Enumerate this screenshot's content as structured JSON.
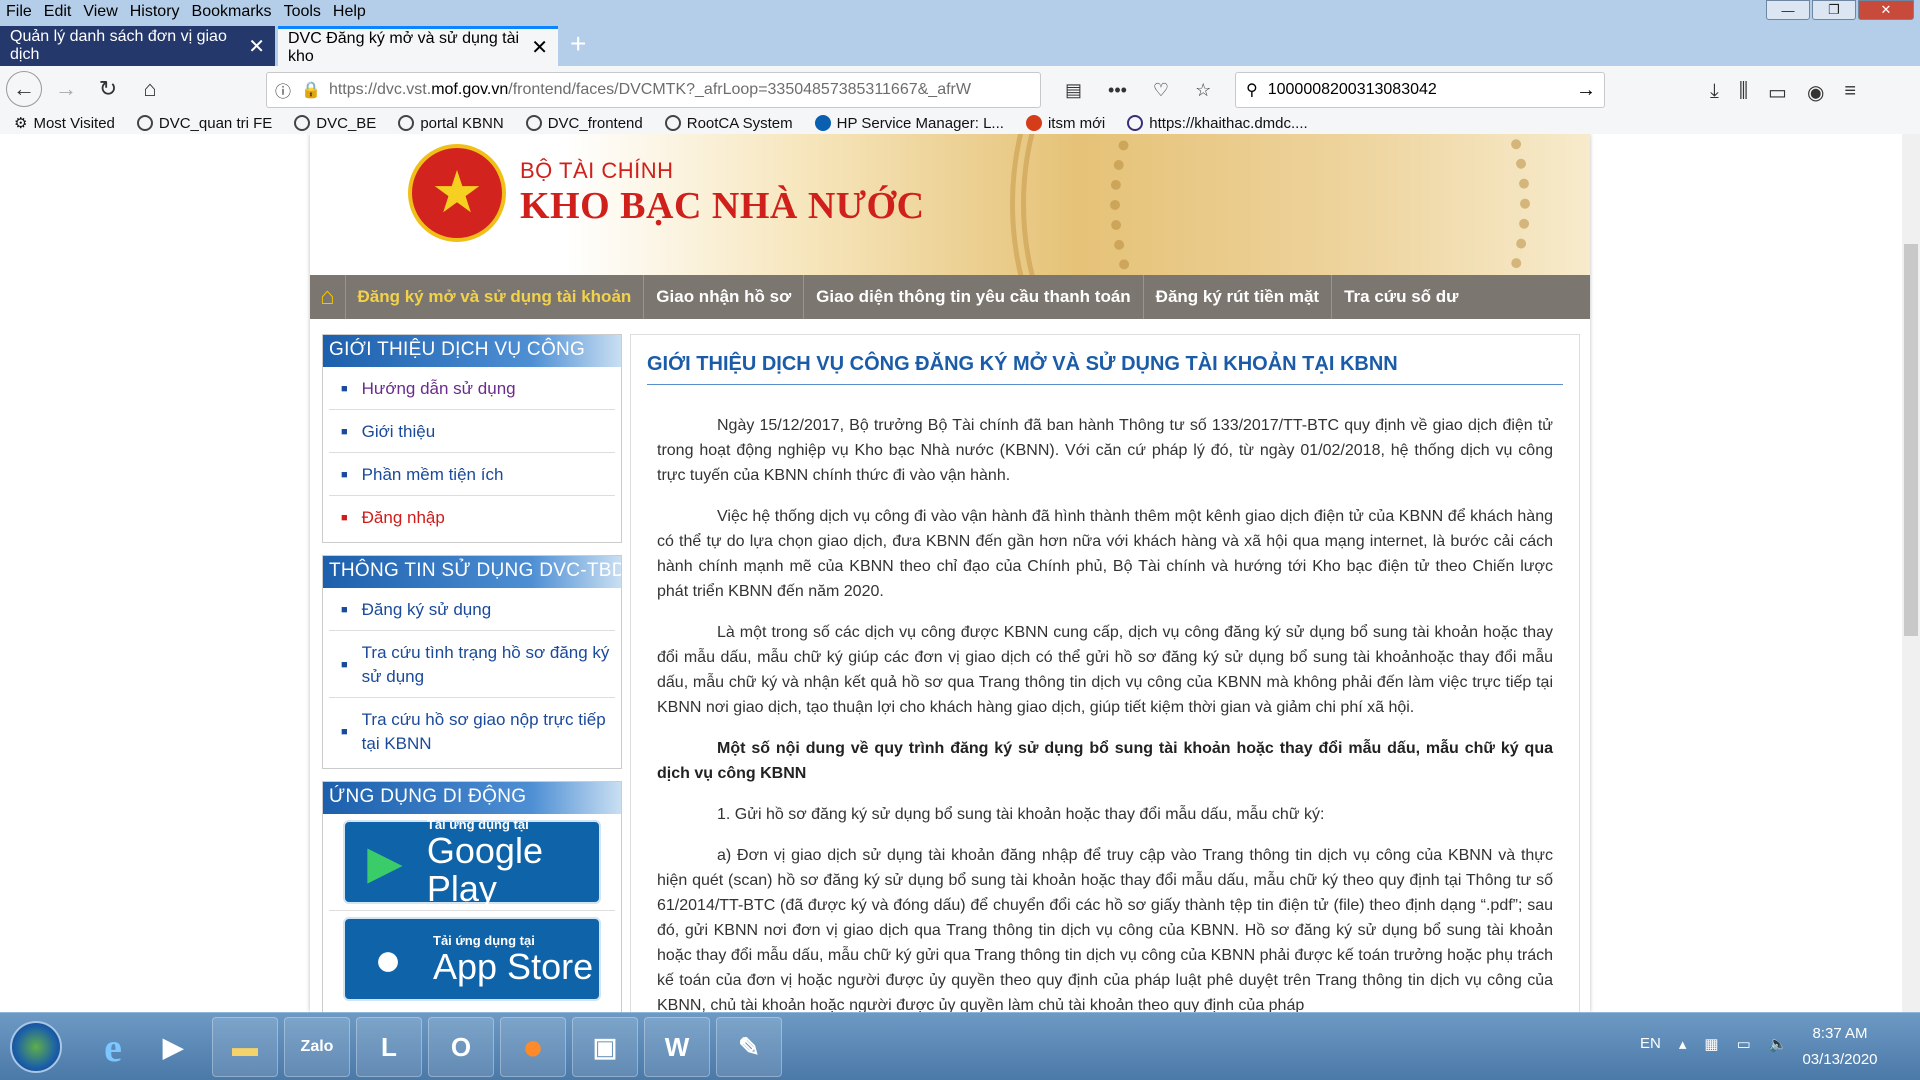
{
  "menu": [
    "File",
    "Edit",
    "View",
    "History",
    "Bookmarks",
    "Tools",
    "Help"
  ],
  "tabs": [
    {
      "title": "Quản lý danh sách đơn vị giao dịch"
    },
    {
      "title": "DVC Đăng ký mở và sử dụng tài kho"
    }
  ],
  "url": {
    "prefix": "https://dvc.vst.",
    "domain": "mof.gov.vn",
    "path": "/frontend/faces/DVCMTK?_afrLoop=33504857385311667&_afrW"
  },
  "search_value": "1000008200313083042",
  "bookmarks": [
    "Most Visited",
    "DVC_quan tri FE",
    "DVC_BE",
    "portal KBNN",
    "DVC_frontend",
    "RootCA System",
    "HP Service Manager: L...",
    "itsm mới",
    "https://khaithac.dmdc...."
  ],
  "header": {
    "ministry": "BỘ TÀI CHÍNH",
    "treasury": "KHO BẠC NHÀ NƯỚC"
  },
  "topnav": [
    "Đăng ký mở và sử dụng tài khoản",
    "Giao nhận hồ sơ",
    "Giao diện thông tin yêu cầu thanh toán",
    "Đăng ký rút tiền mặt",
    "Tra cứu số dư"
  ],
  "sidebar": {
    "intro_title": "GIỚI THIỆU DỊCH VỤ CÔNG",
    "intro_links": [
      "Hướng dẫn sử dụng",
      "Giới thiệu",
      "Phần mềm tiện ích",
      "Đăng nhập"
    ],
    "usage_title": "THÔNG TIN SỬ DỤNG DVC-TBDĐ",
    "usage_links": [
      "Đăng ký sử dụng",
      "Tra cứu tình trạng hồ sơ đăng ký sử dụng",
      "Tra cứu hồ sơ giao nộp trực tiếp tại KBNN"
    ],
    "mobile_title": "ỨNG DỤNG DI ĐỘNG",
    "google": {
      "small": "Tải ứng dụng tại",
      "big": "Google Play"
    },
    "apple": {
      "small": "Tải ứng dụng tại",
      "big": "App Store"
    }
  },
  "content": {
    "title": "GIỚI THIỆU DỊCH VỤ CÔNG ĐĂNG KÝ MỞ VÀ SỬ DỤNG TÀI KHOẢN TẠI KBNN",
    "p1": "Ngày 15/12/2017, Bộ trưởng Bộ Tài chính đã ban hành Thông tư số 133/2017/TT-BTC quy định về giao dịch điện tử trong hoạt động nghiệp vụ Kho bạc Nhà nước (KBNN). Với căn cứ pháp lý đó, từ ngày 01/02/2018, hệ thống dịch vụ công trực tuyến của KBNN chính thức đi vào vận hành.",
    "p2": "Việc hệ thống dịch vụ công đi vào vận hành đã hình thành thêm một kênh giao dịch điện tử của KBNN để khách hàng có thể tự do lựa chọn giao dịch, đưa KBNN đến gần hơn nữa với khách hàng và xã hội qua mạng internet, là bước cải cách hành chính mạnh mẽ của KBNN theo chỉ đạo của Chính phủ, Bộ Tài chính và hướng tới Kho bạc điện tử theo Chiến lược phát triển KBNN đến năm 2020.",
    "p3": "Là một trong số các dịch vụ công được KBNN cung cấp, dịch vụ công đăng ký sử dụng bổ sung tài khoản hoặc thay đổi mẫu dấu, mẫu chữ ký giúp các đơn vị giao dịch có thể gửi hồ sơ đăng ký sử dụng bổ sung tài khoảnhoặc thay đổi mẫu dấu, mẫu chữ ký và nhận kết quả hồ sơ qua Trang thông tin dịch vụ công của KBNN mà không phải đến làm việc trực tiếp tại KBNN nơi giao dịch, tạo thuận lợi cho khách hàng giao dịch, giúp tiết kiệm thời gian và giảm chi phí xã hội.",
    "p4": "Một số nội dung về quy trình đăng ký sử dụng bổ sung tài khoản hoặc thay đổi mẫu dấu, mẫu chữ ký qua dịch vụ công KBNN",
    "p5": "1. Gửi hồ sơ đăng ký sử dụng bổ sung tài khoản hoặc thay đổi mẫu dấu, mẫu chữ ký:",
    "p6": "a) Đơn vị giao dịch sử dụng tài khoản đăng nhập để truy cập vào Trang thông tin dịch vụ công của KBNN và thực hiện quét (scan) hồ sơ đăng ký sử dụng bổ sung tài khoản hoặc thay đổi mẫu dấu, mẫu chữ ký theo quy định tại Thông tư số 61/2014/TT-BTC (đã được ký và đóng dấu) để chuyển đổi các hồ sơ giấy thành tệp tin điện tử (file) theo định dạng “.pdf”; sau đó, gửi KBNN nơi đơn vị giao dịch qua Trang thông tin dịch vụ công của KBNN. Hồ sơ đăng ký sử dụng bổ sung tài khoản hoặc thay đổi mẫu dấu, mẫu chữ ký gửi qua Trang thông tin dịch vụ công của KBNN phải được kế toán trưởng hoặc phụ trách kế toán của đơn vị hoặc người được ủy quyền theo quy định của pháp luật phê duyệt trên Trang thông tin dịch vụ công của KBNN, chủ tài khoản hoặc người được ủy quyền làm chủ tài khoản theo quy định của pháp"
  },
  "taskbar": {
    "lang": "EN",
    "time": "8:37 AM",
    "date": "03/13/2020"
  }
}
